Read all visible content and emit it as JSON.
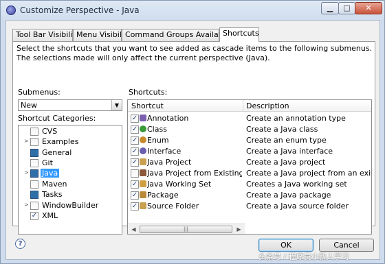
{
  "window": {
    "title": "Customize Perspective - Java"
  },
  "tabs": [
    {
      "label": "Tool Bar Visibility"
    },
    {
      "label": "Menu Visibility"
    },
    {
      "label": "Command Groups Availability"
    },
    {
      "label": "Shortcuts",
      "active": true
    }
  ],
  "description": "Select the shortcuts that you want to see added as cascade items to the following submenus.  The selections made will only affect the current perspective (Java).",
  "submenus": {
    "label": "Submenus:",
    "selected": "New"
  },
  "categories": {
    "label": "Shortcut Categories:",
    "items": [
      {
        "name": "CVS",
        "expandable": false,
        "checked": false
      },
      {
        "name": "Examples",
        "expandable": true,
        "checked": false
      },
      {
        "name": "General",
        "expandable": false,
        "checked": "partial"
      },
      {
        "name": "Git",
        "expandable": false,
        "checked": false
      },
      {
        "name": "Java",
        "expandable": true,
        "checked": "partial",
        "selected": true
      },
      {
        "name": "Maven",
        "expandable": false,
        "checked": false
      },
      {
        "name": "Tasks",
        "expandable": false,
        "checked": "partial"
      },
      {
        "name": "WindowBuilder",
        "expandable": true,
        "checked": false
      },
      {
        "name": "XML",
        "expandable": false,
        "checked": true
      }
    ]
  },
  "shortcuts": {
    "label": "Shortcuts:",
    "columns": [
      "Shortcut",
      "Description"
    ],
    "rows": [
      {
        "name": "Annotation",
        "description": "Create an annotation type",
        "checked": true,
        "icon": "annotation-icon",
        "icon_color": "#7a5fb0"
      },
      {
        "name": "Class",
        "description": "Create a Java class",
        "checked": true,
        "icon": "class-icon",
        "icon_color": "#3a9a3a"
      },
      {
        "name": "Enum",
        "description": "Create an enum type",
        "checked": true,
        "icon": "enum-icon",
        "icon_color": "#c88a2a"
      },
      {
        "name": "Interface",
        "description": "Create a Java interface",
        "checked": true,
        "icon": "interface-icon",
        "icon_color": "#6a5fb0"
      },
      {
        "name": "Java Project",
        "description": "Create a Java project",
        "checked": true,
        "icon": "java-project-icon",
        "icon_color": "#c8a050"
      },
      {
        "name": "Java Project from Existing Ant...",
        "description": "Create a Java project from an existing Ant",
        "checked": false,
        "icon": "ant-project-icon",
        "icon_color": "#8a5a3a"
      },
      {
        "name": "Java Working Set",
        "description": "Creates a Java working set",
        "checked": true,
        "icon": "working-set-icon",
        "icon_color": "#d0a040"
      },
      {
        "name": "Package",
        "description": "Create a Java package",
        "checked": true,
        "icon": "package-icon",
        "icon_color": "#b88a3a"
      },
      {
        "name": "Source Folder",
        "description": "Create a Java source folder",
        "checked": true,
        "icon": "source-folder-icon",
        "icon_color": "#c8a050"
      }
    ]
  },
  "buttons": {
    "ok": "OK",
    "cancel": "Cancel"
  },
  "watermark": "头条号 / 程序员小新人学习"
}
